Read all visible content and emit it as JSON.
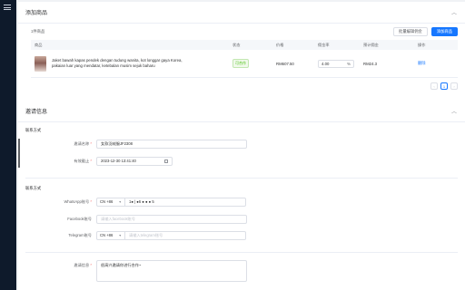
{
  "sidebar": {
    "menu_icon": "menu-fold-icon"
  },
  "products": {
    "title": "添加商品",
    "count_text": "1件商品",
    "batch_button": "批量编辑佣金",
    "add_button": "添加商品",
    "columns": [
      "商品",
      "状态",
      "价格",
      "佣金率",
      "预计佣金",
      "操作"
    ],
    "rows": [
      {
        "name": "Jaket bawah kapas pendek dengan tudung wanita, kot longgar gaya Korea, pakaian luar yang mendatar, ketebalan musim sejuk baharu",
        "status": "可合作",
        "price": "RM607.50",
        "commission_rate": "4.00",
        "commission_suffix": "%",
        "est_commission": "RM24.3",
        "op": "删除"
      }
    ],
    "pager": {
      "prev": "‹",
      "current": "1",
      "next": "›"
    }
  },
  "invite": {
    "title": "邀请信息",
    "section_contact": "联系方式",
    "invite_name_label": "邀请名称",
    "invite_name_value": "女款羽绒服JF2308",
    "deadline_label": "有效截止",
    "deadline_value": "2023-12-30 13:41:40",
    "section_contact2": "联系方式",
    "whatsapp_label": "WhatsApp账号",
    "whatsapp_code": "CN +86",
    "whatsapp_value": "1● | ●6 ● ● ● 5",
    "facebook_label": "Facebook账号",
    "facebook_placeholder": "请输入facebook账号",
    "telegram_label": "Telegram账号",
    "telegram_code": "CN +86",
    "telegram_placeholder": "请输入telegram账号",
    "message_label": "邀请信息",
    "message_value": "很高兴邀请你进行合作~"
  },
  "colors": {
    "accent": "#1677ff",
    "sidebar": "#0e1a2b",
    "success": "#52c41a",
    "required": "#f56c6c"
  }
}
